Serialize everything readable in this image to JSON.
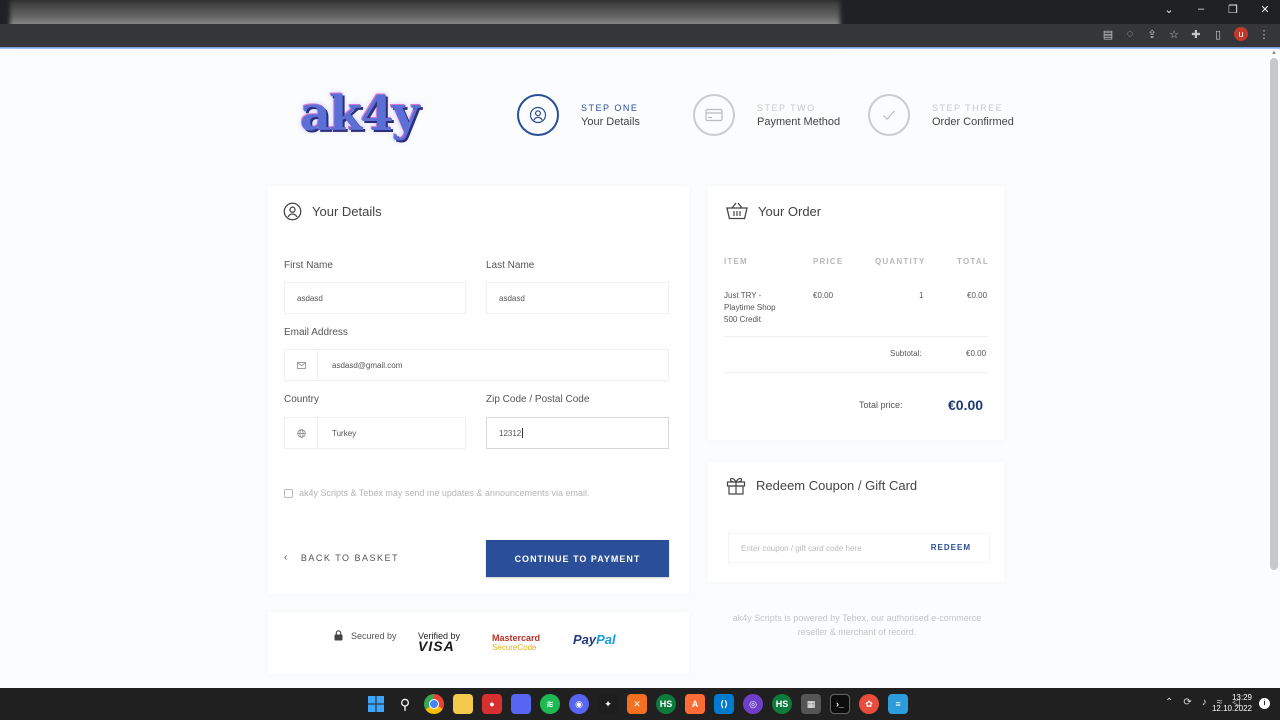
{
  "browser": {
    "controls": [
      "⌄",
      "–",
      "❐",
      "✕"
    ],
    "profile_initial": "u"
  },
  "brand": {
    "logo_text": "ak4y"
  },
  "steps": [
    {
      "number": "STEP ONE",
      "label": "Your Details",
      "active": true
    },
    {
      "number": "STEP TWO",
      "label": "Payment Method",
      "active": false
    },
    {
      "number": "STEP THREE",
      "label": "Order Confirmed",
      "active": false
    }
  ],
  "details": {
    "title": "Your Details",
    "first_name_label": "First Name",
    "first_name_value": "asdasd",
    "last_name_label": "Last Name",
    "last_name_value": "asdasd",
    "email_label": "Email Address",
    "email_value": "asdasd@gmail.com",
    "country_label": "Country",
    "country_value": "Turkey",
    "zip_label": "Zip Code / Postal Code",
    "zip_value": "12312",
    "consent_text": "ak4y Scripts & Tebex may send me updates & announcements via email.",
    "back_label": "BACK TO BASKET",
    "continue_label": "CONTINUE TO PAYMENT"
  },
  "security": {
    "secured_by": "Secured by",
    "visa_top": "Verified by",
    "visa_bottom": "VISA",
    "mc_top_brand": "Mastercard",
    "mc_bottom": "SecureCode",
    "paypal_a": "Pay",
    "paypal_b": "Pal"
  },
  "order": {
    "title": "Your Order",
    "headers": {
      "item": "ITEM",
      "price": "PRICE",
      "quantity": "QUANTITY",
      "total": "TOTAL"
    },
    "row": {
      "item_line1": "Just TRY -",
      "item_line2": "Playtime Shop",
      "item_line3": "500 Credit",
      "price": "€0.00",
      "quantity": "1",
      "total": "€0.00"
    },
    "subtotal_label": "Subtotal:",
    "subtotal_value": "€0.00",
    "total_label": "Total price:",
    "total_value": "€0.00"
  },
  "coupon": {
    "title": "Redeem Coupon / Gift Card",
    "placeholder": "Enter coupon / gift card code here",
    "button": "REDEEM"
  },
  "footer": {
    "line1": "ak4y Scripts is powered by Tebex, our authorised e-commerce",
    "line2": "reseller & merchant of record."
  },
  "taskbar": {
    "time": "13:29",
    "date": "12.10.2022"
  },
  "colors": {
    "primary": "#2b4e99",
    "price": "#1e3a75"
  }
}
